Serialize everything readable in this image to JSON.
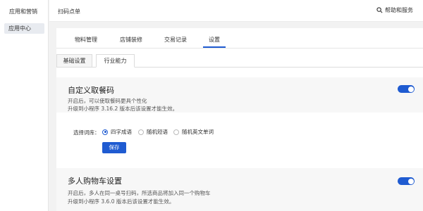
{
  "sidebar": {
    "title": "应用和营销",
    "item": "应用中心"
  },
  "topbar": {
    "title": "扫码点单",
    "help": "帮助和服务"
  },
  "tabs": [
    {
      "label": "物料管理"
    },
    {
      "label": "店铺装修"
    },
    {
      "label": "交易记录"
    },
    {
      "label": "设置"
    }
  ],
  "subtabs": [
    {
      "label": "基础设置"
    },
    {
      "label": "行业能力"
    }
  ],
  "custom_code": {
    "title": "自定义取餐码",
    "desc1": "开启后，可以使取餐码更具个性化",
    "desc2": "升级到小程序 3.16.2 版本后该设置才能生效。",
    "enabled": true
  },
  "dict": {
    "label": "选择词库：",
    "options": [
      "四字成语",
      "随机短语",
      "随机英文单词"
    ],
    "selected_index": 0,
    "save_label": "保存"
  },
  "multi_cart": {
    "title": "多人购物车设置",
    "desc1": "开启后，多人在同一桌号扫码，所选商品将加入同一个购物车",
    "desc2": "升级到小程序 3.6.0 版本后该设置才能生效。",
    "enabled": true
  },
  "colors": {
    "accent": "#1f5bd1"
  }
}
